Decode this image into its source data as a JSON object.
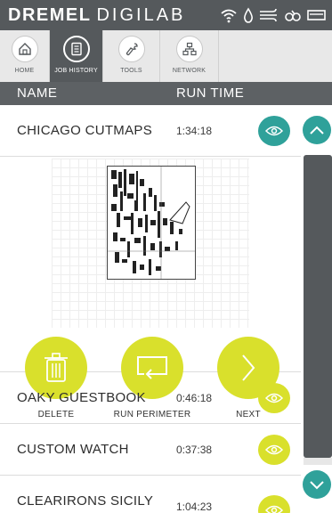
{
  "header": {
    "brand_bold": "DREMEL",
    "brand_light": "DIGILAB",
    "status_icons": [
      "wifi-icon",
      "water-drop-icon",
      "airflow-icon",
      "link-icon",
      "battery-icon"
    ]
  },
  "tabs": [
    {
      "label": "HOME",
      "icon": "home-icon"
    },
    {
      "label": "JOB HISTORY",
      "icon": "job-history-icon"
    },
    {
      "label": "TOOLS",
      "icon": "wrench-icon"
    },
    {
      "label": "NETWORK",
      "icon": "network-icon"
    }
  ],
  "columns": {
    "name": "NAME",
    "run_time": "RUN TIME"
  },
  "jobs": [
    {
      "name": "CHICAGO CUTMAPS",
      "time": "1:34:18",
      "expanded": true
    },
    {
      "name": "OAKY GUESTBOOK",
      "time": "0:46:18"
    },
    {
      "name": "CUSTOM WATCH",
      "time": "0:37:38"
    },
    {
      "name": "CLEARIRONS SICILY",
      "time": "1:04:23"
    }
  ],
  "actions": {
    "delete": "DELETE",
    "run_perimeter": "RUN PERIMETER",
    "next": "NEXT"
  },
  "colors": {
    "header_bg": "#55595c",
    "accent_teal": "#2fa19a",
    "accent_yellow": "#d9e02c"
  }
}
